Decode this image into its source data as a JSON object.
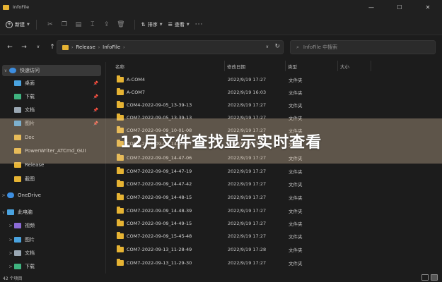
{
  "window": {
    "title": "InfoFile",
    "controls": {
      "minimize": "—",
      "maximize": "☐",
      "close": "✕"
    }
  },
  "toolbar": {
    "new_label": "新建",
    "sort_label": "排序",
    "view_label": "查看",
    "more": "···"
  },
  "address": {
    "crumbs": [
      "Release",
      "InfoFile"
    ],
    "search_placeholder": "InfoFile 中搜索"
  },
  "sidebar": {
    "items": [
      {
        "label": "快速访问",
        "icon": "star-icon",
        "color": "#3d8ee0",
        "level": 0,
        "chevron": "∨",
        "selected": true
      },
      {
        "label": "桌面",
        "icon": "desktop-icon",
        "color": "#4aa3df",
        "level": 1,
        "pinned": true
      },
      {
        "label": "下载",
        "icon": "download-icon",
        "color": "#3fb37f",
        "level": 1,
        "pinned": true
      },
      {
        "label": "文档",
        "icon": "document-icon",
        "color": "#9aa7b3",
        "level": 1,
        "pinned": true
      },
      {
        "label": "图片",
        "icon": "picture-icon",
        "color": "#4aa3df",
        "level": 1,
        "pinned": true
      },
      {
        "label": "Doc",
        "icon": "folder-icon",
        "color": "#e6b333",
        "level": 1
      },
      {
        "label": "PowerWriter_ATCmd_GUI",
        "icon": "folder-icon",
        "color": "#e6b333",
        "level": 1
      },
      {
        "label": "Release",
        "icon": "folder-icon",
        "color": "#e6b333",
        "level": 1
      },
      {
        "label": "截图",
        "icon": "folder-icon",
        "color": "#e6b333",
        "level": 1
      },
      {
        "label": "OneDrive",
        "icon": "cloud-icon",
        "color": "#3d8ee0",
        "level": 0,
        "chevron": ">"
      },
      {
        "label": "此电脑",
        "icon": "computer-icon",
        "color": "#4aa3df",
        "level": 0,
        "chevron": "∨"
      },
      {
        "label": "视频",
        "icon": "video-icon",
        "color": "#8c6bd6",
        "level": 1,
        "chevron": ">"
      },
      {
        "label": "图片",
        "icon": "picture-icon",
        "color": "#4aa3df",
        "level": 1,
        "chevron": ">"
      },
      {
        "label": "文档",
        "icon": "document-icon",
        "color": "#9aa7b3",
        "level": 1,
        "chevron": ">"
      },
      {
        "label": "下载",
        "icon": "download-icon",
        "color": "#3fb37f",
        "level": 1,
        "chevron": ">"
      }
    ]
  },
  "columns": {
    "name": "名称",
    "date": "修改日期",
    "type": "类型",
    "size": "大小"
  },
  "files": [
    {
      "name": "A-COM4",
      "date": "2022/9/19 17:27",
      "type": "文件夹"
    },
    {
      "name": "A-COM7",
      "date": "2022/9/19 16:03",
      "type": "文件夹"
    },
    {
      "name": "COM4-2022-09-05_13-39-13",
      "date": "2022/9/19 17:27",
      "type": "文件夹"
    },
    {
      "name": "COM7-2022-09-05_13-39-13",
      "date": "2022/9/19 17:27",
      "type": "文件夹"
    },
    {
      "name": "COM7-2022-09-09_10-01-08",
      "date": "2022/9/19 17:27",
      "type": "文件夹"
    },
    {
      "name": "COM7-2022-09-09_14-40-27",
      "date": "2022/9/19 17:27",
      "type": "文件夹"
    },
    {
      "name": "COM7-2022-09-09_14-47-06",
      "date": "2022/9/19 17:27",
      "type": "文件夹"
    },
    {
      "name": "COM7-2022-09-09_14-47-19",
      "date": "2022/9/19 17:27",
      "type": "文件夹"
    },
    {
      "name": "COM7-2022-09-09_14-47-42",
      "date": "2022/9/19 17:27",
      "type": "文件夹"
    },
    {
      "name": "COM7-2022-09-09_14-48-15",
      "date": "2022/9/19 17:27",
      "type": "文件夹"
    },
    {
      "name": "COM7-2022-09-09_14-48-39",
      "date": "2022/9/19 17:27",
      "type": "文件夹"
    },
    {
      "name": "COM7-2022-09-09_14-49-15",
      "date": "2022/9/19 17:27",
      "type": "文件夹"
    },
    {
      "name": "COM7-2022-09-09_15-45-48",
      "date": "2022/9/19 17:27",
      "type": "文件夹"
    },
    {
      "name": "COM7-2022-09-13_11-28-49",
      "date": "2022/9/19 17:28",
      "type": "文件夹"
    },
    {
      "name": "COM7-2022-09-13_11-29-30",
      "date": "2022/9/19 17:27",
      "type": "文件夹"
    }
  ],
  "overlay": {
    "title": "12月文件查找显示实时查看"
  },
  "status": {
    "count": "42 个项目"
  }
}
